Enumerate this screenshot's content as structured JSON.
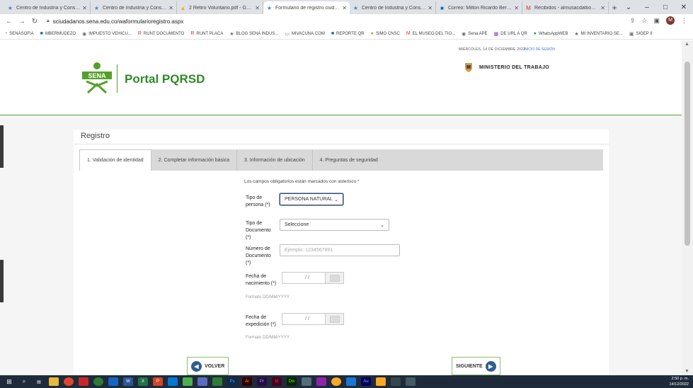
{
  "browser": {
    "tabs": [
      {
        "title": "Centro de Industria y Construcc",
        "active": false
      },
      {
        "title": "Centro de Industria y Construcc",
        "active": false
      },
      {
        "title": "2 Retiro Voluntario.pdf - Google",
        "active": false
      },
      {
        "title": "Formulario de registro ciudadan",
        "active": true
      },
      {
        "title": "Centro de Industria y Construcc",
        "active": false
      },
      {
        "title": "Correo: Milton Ricardo Bermud",
        "active": false
      },
      {
        "title": "Recibidos - almusacdattiomilto",
        "active": false
      }
    ],
    "url": "sciudadanos.sena.edu.co/waformularioregistro.aspx",
    "profile_initial": "M",
    "bookmarks": [
      "SENASOFIA",
      "MBERMUDEZO",
      "IMPUESTO VEHICU...",
      "RUNT DOCUMENTO",
      "RUNT PLACA",
      "BLOG SENA INDUS...",
      "MIVACUNA.COM",
      "REPORTE QR",
      "SIMO CNSC",
      "EL MUSEO DEL TIO...",
      "Sena APE",
      "DE URL A QR",
      "WhatsAppWEB",
      "MI INVENTARIO.SE...",
      "SIGEP II"
    ]
  },
  "header": {
    "logo_text": "SENA",
    "portal_title": "Portal PQRSD",
    "date": "MIÉRCOLES, 14 DE DICIEMBRE 2022",
    "login": "INICIO DE SESIÓN",
    "ministry": "MINISTERIO DEL TRABAJO"
  },
  "form": {
    "title": "Registro",
    "tabs": [
      "1. Validación de identidad",
      "2. Completar información básica",
      "3. Información de ubicación",
      "4. Preguntas de seguridad"
    ],
    "required_note": "Los campos obligatorios están marcados con asterisco *",
    "tipo_persona_label": "Tipo de persona (*)",
    "tipo_persona_value": "PERSONA NATURAL",
    "tipo_documento_label": "Tipo de Documento (*)",
    "tipo_documento_value": "Seleccione",
    "numero_documento_label": "Número de Documento (*)",
    "numero_documento_placeholder": "Ejemplo: 1234567891",
    "fecha_nacimiento_label": "Fecha de nacimiento (*)",
    "fecha_expedicion_label": "Fecha de expedición (*)",
    "date_placeholder": "/ /",
    "date_format": "Formato DD/MM/YYYY",
    "back_label": "VOLVER",
    "next_label": "SIGUIENTE"
  },
  "taskbar": {
    "time": "2:50 p. m.",
    "date": "14/12/2022"
  },
  "colors": {
    "brand_green": "#2f8a26",
    "accent_blue": "#2f5f8f"
  }
}
